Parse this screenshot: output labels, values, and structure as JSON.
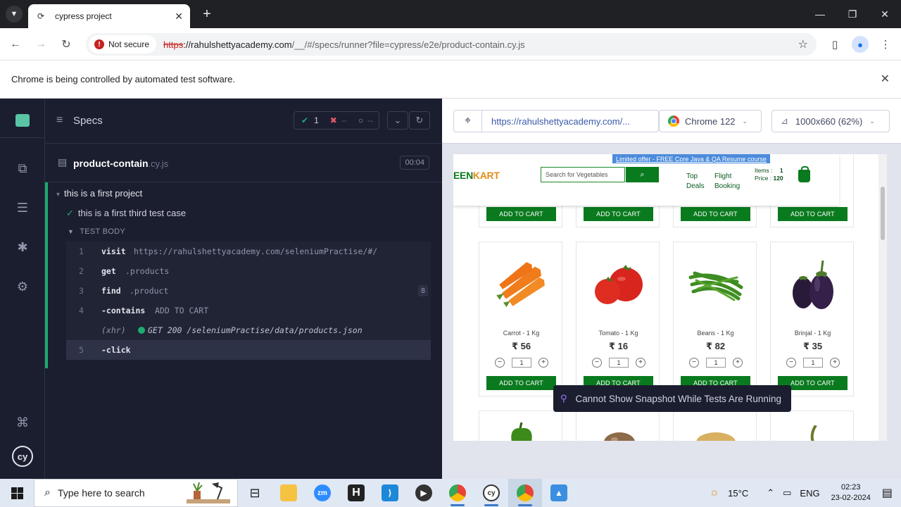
{
  "browser": {
    "tab_title": "cypress project",
    "security_label": "Not secure",
    "url_scheme": "https",
    "url_host": "://rahulshettyacademy.com",
    "url_path": "/__/#/specs/runner?file=cypress/e2e/product-contain.cy.js",
    "infobar_text": "Chrome is being controlled by automated test software."
  },
  "reporter": {
    "specs_label": "Specs",
    "passed_count": "1",
    "failed_count": "--",
    "pending_count": "--",
    "spec_name": "product-contain",
    "spec_ext": ".cy.js",
    "duration": "00:04",
    "suite_title": "this is a first project",
    "test_title": "this is a first third test case",
    "test_body_label": "TEST BODY",
    "commands": [
      {
        "num": "1",
        "name": "visit",
        "msg": "https://rahulshettyacademy.com/seleniumPractise/#/"
      },
      {
        "num": "2",
        "name": "get",
        "msg": ".products"
      },
      {
        "num": "3",
        "name": "find",
        "msg": ".product",
        "badge": "8"
      },
      {
        "num": "4",
        "name": "-contains",
        "msg": "ADD TO CART"
      },
      {
        "num": "",
        "name": "(xhr)",
        "msg": "GET 200 /seleniumPractise/data/products.json"
      },
      {
        "num": "5",
        "name": "-click",
        "msg": ""
      }
    ]
  },
  "aut": {
    "url": "https://rahulshettyacademy.com/...",
    "browser_label": "Chrome 122",
    "viewport_label": "1000x660 (62%)",
    "snapshot_message": "Cannot Show Snapshot While Tests Are Running"
  },
  "greenkart": {
    "offer": "Limited offer - FREE Core Java & QA Resume course",
    "logo_part1": "EEN",
    "logo_part2": "KART",
    "search_placeholder": "Search for Vegetables",
    "link_top_deals_1": "Top",
    "link_top_deals_2": "Deals",
    "link_flight_1": "Flight",
    "link_flight_2": "Booking",
    "items_label": "Items  :",
    "items_value": "1",
    "price_label": "Price  :",
    "price_value": "120",
    "add_label": "ADD TO CART",
    "products": [
      {
        "name": "Carrot - 1 Kg",
        "price": "₹ 56",
        "qty": "1"
      },
      {
        "name": "Tomato - 1 Kg",
        "price": "₹ 16",
        "qty": "1"
      },
      {
        "name": "Beans - 1 Kg",
        "price": "₹ 82",
        "qty": "1"
      },
      {
        "name": "Brinjal - 1 Kg",
        "price": "₹ 35",
        "qty": "1"
      }
    ]
  },
  "taskbar": {
    "search_placeholder": "Type here to search",
    "temperature": "15°C",
    "language": "ENG",
    "time": "02:23",
    "date": "23-02-2024"
  },
  "colors": {
    "cypress_pass": "#1fa971",
    "greenkart_green": "#0a7a1e",
    "not_secure_red": "#c5221f"
  }
}
